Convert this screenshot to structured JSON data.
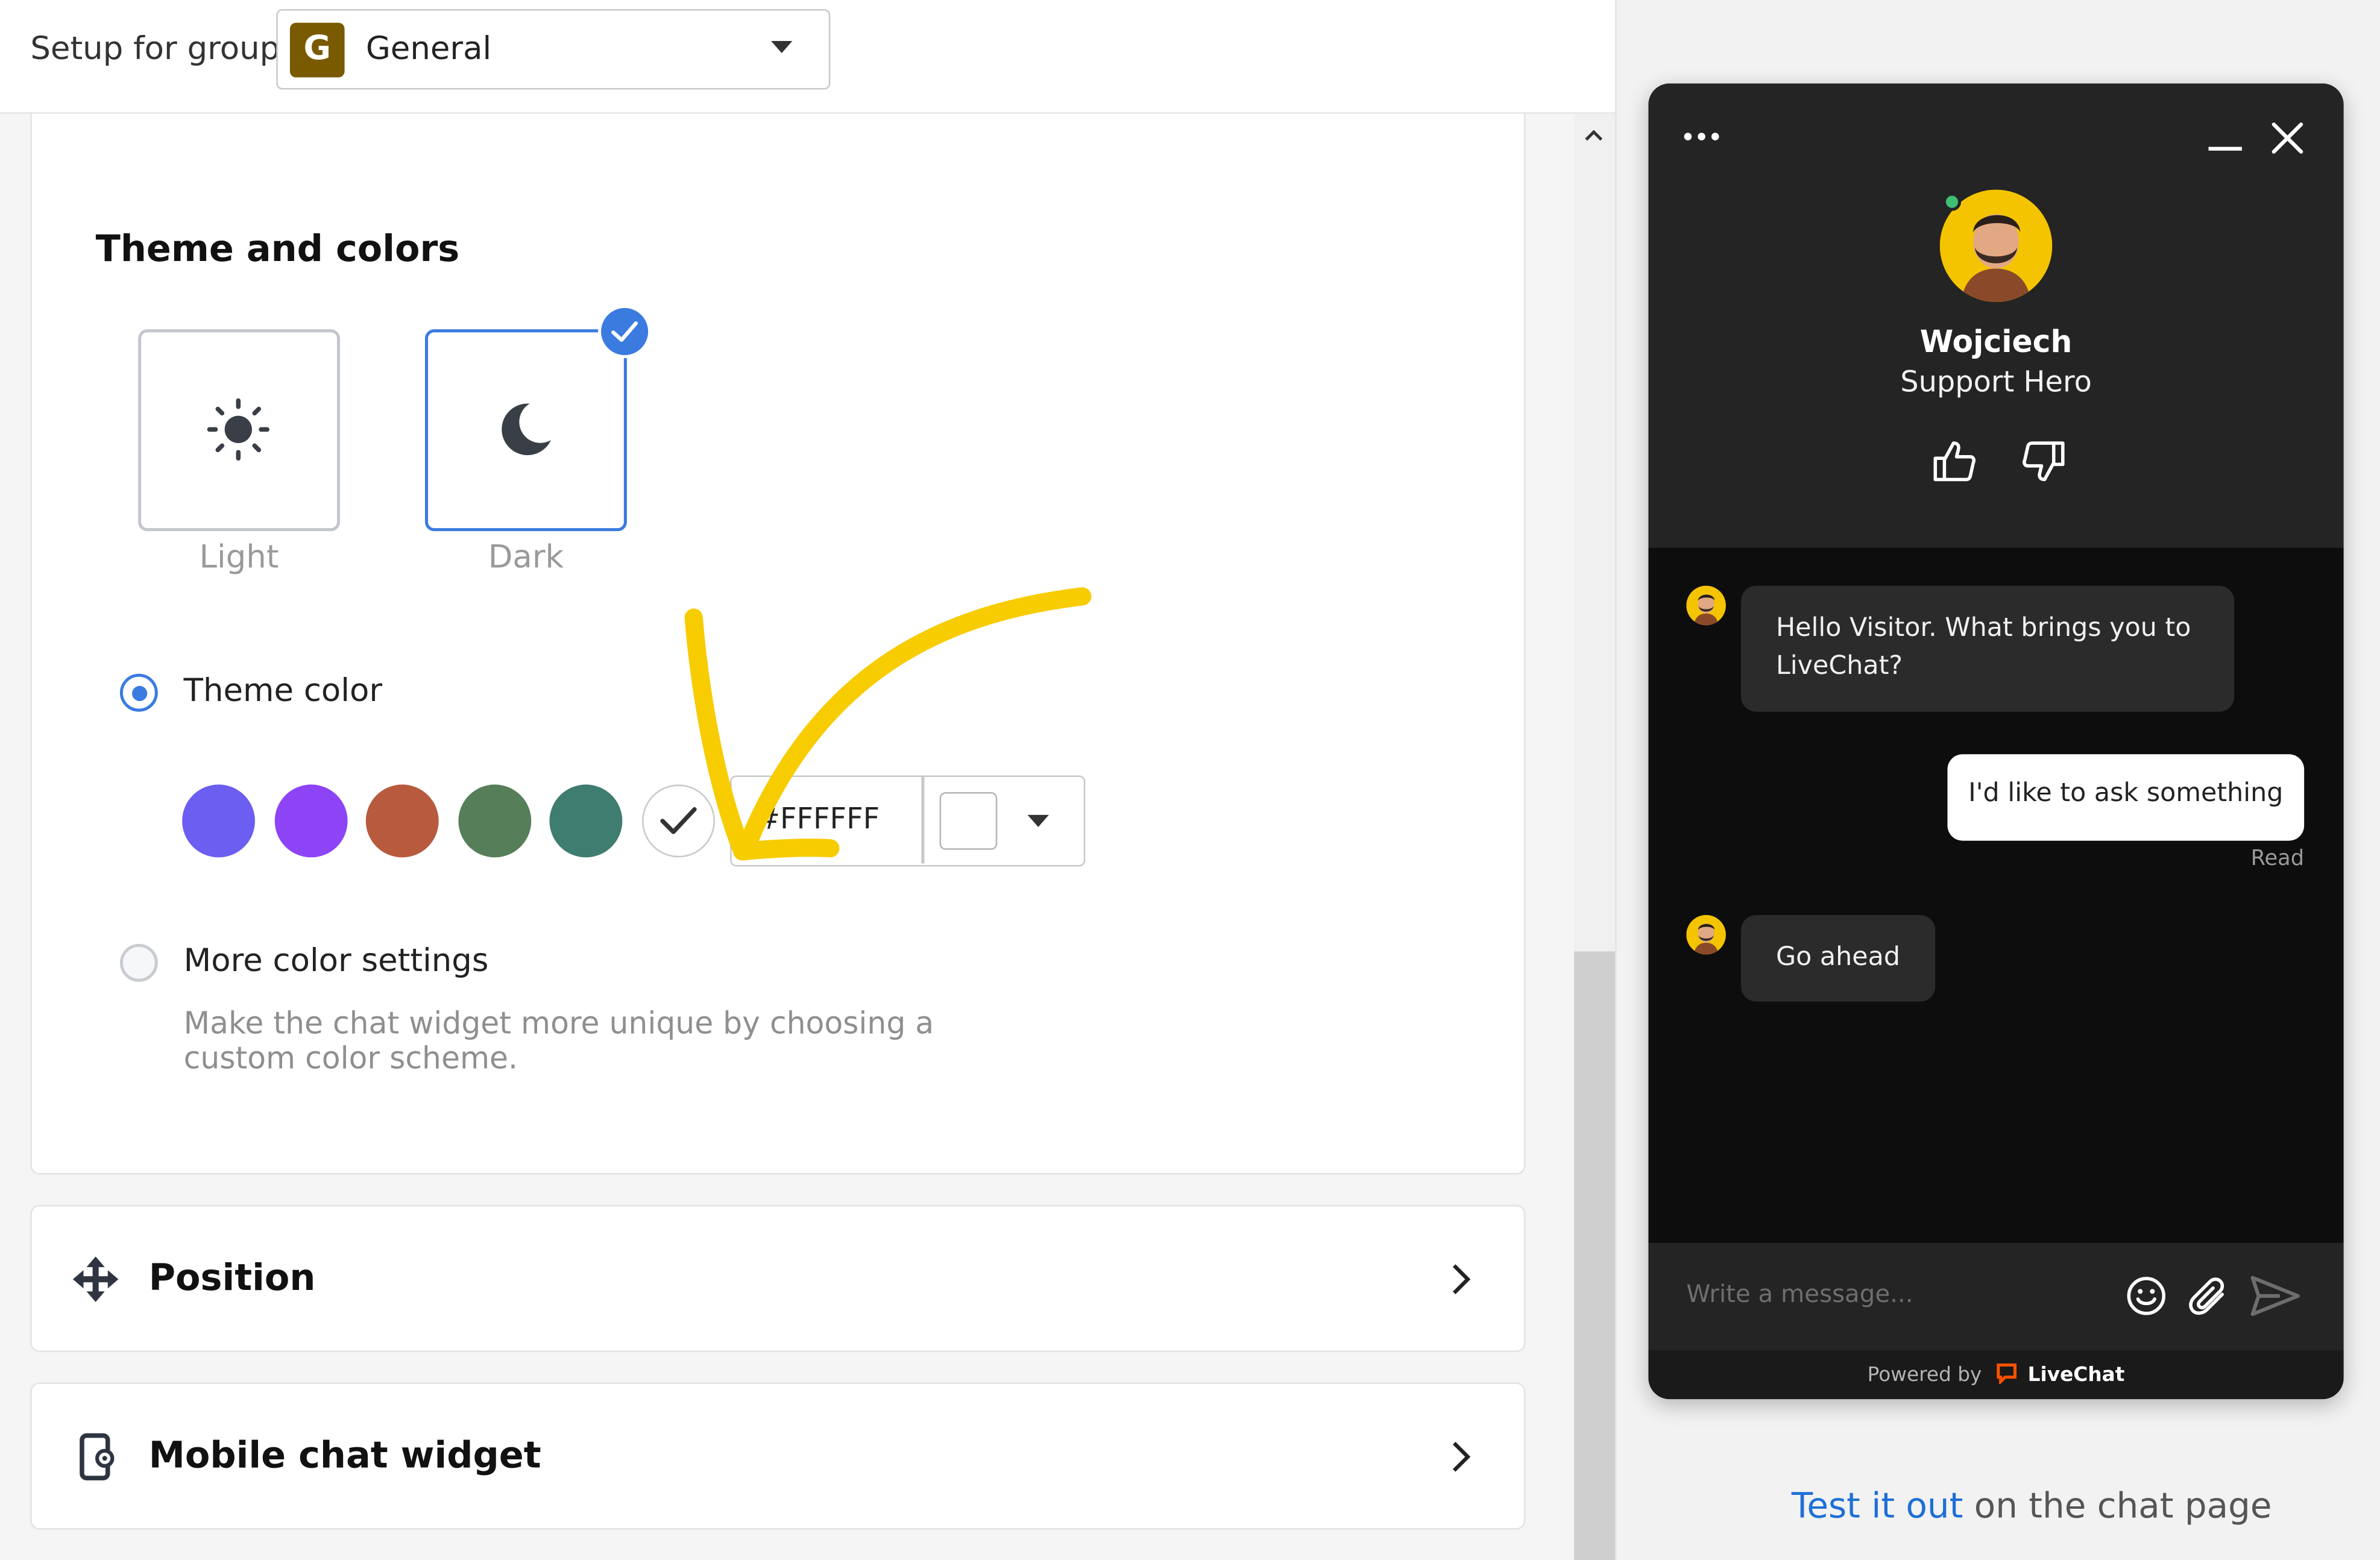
{
  "group_bar": {
    "label": "Setup for group",
    "selected_group": "General",
    "group_initial": "G",
    "group_color": "#7a5a00"
  },
  "theme_section": {
    "title": "Theme and colors",
    "themes": [
      {
        "label": "Light",
        "icon": "sun-icon",
        "selected": false
      },
      {
        "label": "Dark",
        "icon": "moon-icon",
        "selected": true
      }
    ],
    "theme_color_option": {
      "label": "Theme color",
      "selected": true,
      "swatches": [
        "#6c5ef0",
        "#8d44f7",
        "#b85a3e",
        "#567e59",
        "#3e7d70",
        "#ffffff"
      ],
      "selected_swatch": "#ffffff",
      "hex_value": "#FFFFFF"
    },
    "more_colors_option": {
      "label": "More color settings",
      "selected": false,
      "description": "Make the chat widget more unique by choosing a custom color scheme."
    },
    "accent_color": "#3b7be0",
    "annotation_color": "#f7cc00"
  },
  "accordions": [
    {
      "label": "Position",
      "icon": "move-arrows-icon"
    },
    {
      "label": "Mobile chat widget",
      "icon": "mobile-settings-icon"
    }
  ],
  "preview": {
    "agent": {
      "name": "Wojciech",
      "role": "Support Hero",
      "status": "online"
    },
    "messages": [
      {
        "from": "agent",
        "text": "Hello Visitor. What brings you to LiveChat?"
      },
      {
        "from": "visitor",
        "text": "I'd like to ask something",
        "status": "Read"
      },
      {
        "from": "agent",
        "text": "Go ahead"
      }
    ],
    "composer_placeholder": "Write a message...",
    "powered_by": "Powered by",
    "brand": "LiveChat",
    "test_link_text": "Test it out",
    "test_suffix": " on the chat page"
  }
}
